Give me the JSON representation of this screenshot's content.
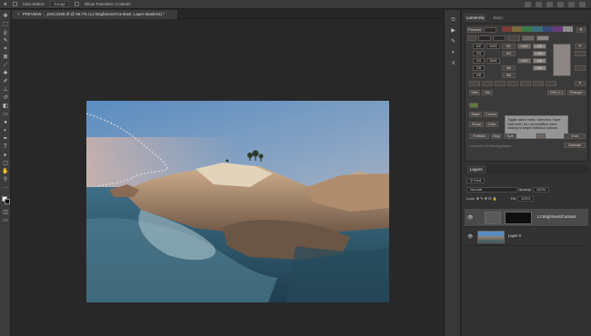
{
  "options_bar": {
    "auto_select_label": "Auto-Select:",
    "auto_select_value": "Group",
    "show_transform_label": "Show Transform Controls"
  },
  "document_tab": {
    "title": "PREVIEW - _DSC3169.tif @ 66.7% (L2 Brightness/Contrast, Layer Mask/16) *"
  },
  "lumenzia": {
    "tabs": [
      "Lumenzia",
      "Basic"
    ],
    "preview_label": "Preview",
    "rows": [
      [
        "D2",
        "DM3",
        "M2",
        "LM3",
        "L2"
      ],
      [
        "D3",
        "",
        "M3",
        "",
        "L3"
      ],
      [
        "D4",
        "DM4",
        "",
        "LM4",
        "L4"
      ],
      [
        "D5",
        "",
        "M5",
        "",
        "L5"
      ],
      [
        "D6",
        "",
        "M6",
        "",
        ""
      ]
    ],
    "row_zone": [
      "zone",
      "",
      "",
      "",
      "",
      "",
      ""
    ],
    "vibe_label": "Vibe",
    "sat_label": "Sat",
    "diff_label": "Diff (+/-)",
    "range_label": "+Range+",
    "mask_label": "Mask",
    "curves_label": "Curves",
    "group_label": "Group",
    "color_label": "Color",
    "prefilled_label": "Prefilled",
    "map_label": "Map",
    "split_label": "Split",
    "vnot_label": "Vnot",
    "tutorials_label": "Tutorials",
    "blending_text": "Lumenzia v11 blending layers",
    "tooltip": "Toggle active mask / selection / layer. Hold shift / alt / ctrl modifiers when clicking to target individual options."
  },
  "layers_panel": {
    "tab_label": "Layers",
    "kind_label": "Kind",
    "blend_mode": "Normal",
    "opacity_label": "Opacity:",
    "opacity_value": "100%",
    "lock_label": "Lock:",
    "fill_label": "Fill:",
    "fill_value": "100%",
    "layers": [
      {
        "name": "L2 Brightness/Contrast",
        "selected": true
      },
      {
        "name": "Layer 0",
        "selected": false
      }
    ]
  },
  "colors": {
    "ps_bg": "#282828",
    "panel": "#323232",
    "accent_sky": "#4f7eb0"
  }
}
